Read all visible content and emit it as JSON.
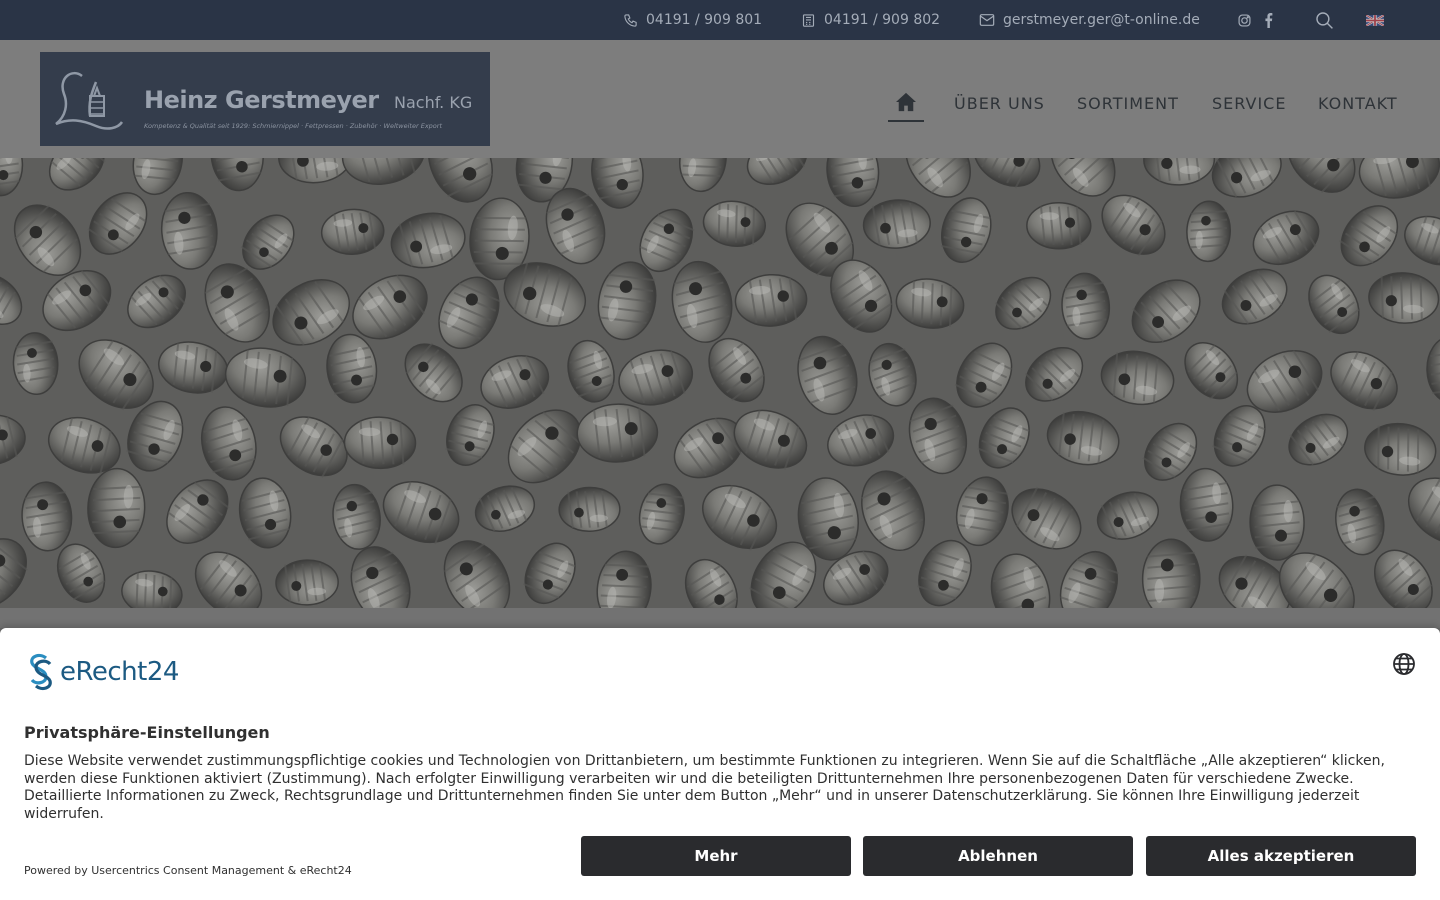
{
  "topbar": {
    "phone": "04191 / 909 801",
    "fax": "04191 / 909 802",
    "email": "gerstmeyer.ger@t-online.de",
    "icons": [
      "phone-icon",
      "fax-icon",
      "mail-icon",
      "instagram-icon",
      "facebook-icon",
      "search-icon",
      "uk-flag-icon"
    ]
  },
  "logo": {
    "name": "Heinz Gerstmeyer",
    "suffix": "Nachf. KG",
    "tagline": "Kompetenz & Qualität seit 1929:  Schmiernippel  ·  Fettpressen  ·  Zubehör  ·  Weltweiter Export"
  },
  "nav": {
    "items": [
      "ÜBER UNS",
      "SORTIMENT",
      "SERVICE",
      "KONTAKT"
    ]
  },
  "consent": {
    "brand": "eRecht24",
    "title": "Privatsphäre-Einstellungen",
    "text": "Diese Website verwendet zustimmungspflichtige cookies und Technologien von Drittanbietern, um bestimmte Funktionen zu integrieren. Wenn Sie auf die Schaltfläche „Alle akzeptieren“ klicken, werden diese Funktionen aktiviert (Zustimmung). Nach erfolgter Einwilligung verarbeiten wir und die beteiligten Drittunternehmen Ihre personenbezogenen Daten für verschiedene Zwecke. Detaillierte Informationen zu Zweck, Rechtsgrundlage und Drittunternehmen finden Sie unter dem Button „Mehr“ und in unserer Datenschutzerklärung. Sie können Ihre Einwilligung jederzeit widerrufen.",
    "powered": "Powered by Usercentrics Consent Management & eRecht24",
    "buttons": {
      "more": "Mehr",
      "decline": "Ablehnen",
      "accept": "Alles akzeptieren"
    }
  },
  "colors": {
    "topbar": "#2a3446",
    "button": "#2a2b2e",
    "brand": "#1c5a82"
  }
}
